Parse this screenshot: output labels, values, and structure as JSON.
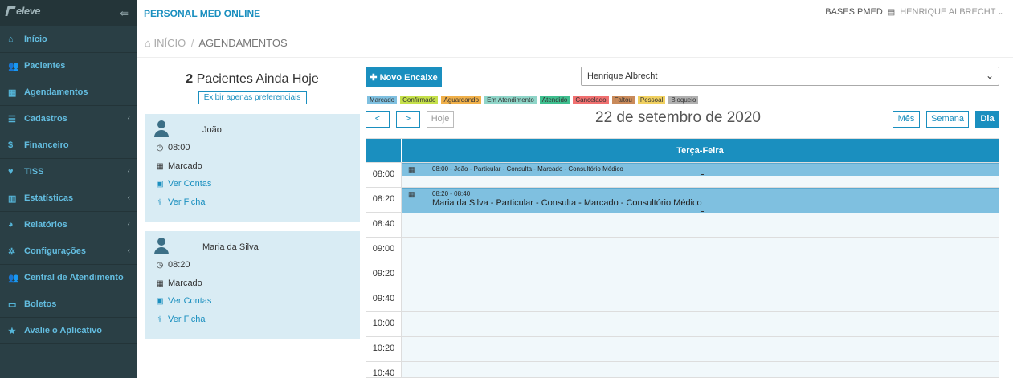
{
  "sidebar": {
    "logo": "eleve",
    "items": [
      {
        "icon": "home-icon",
        "glyph": "⌂",
        "label": "Início",
        "arrow": false
      },
      {
        "icon": "users-icon",
        "glyph": "👥",
        "label": "Pacientes",
        "arrow": false
      },
      {
        "icon": "calendar-icon",
        "glyph": "▦",
        "label": "Agendamentos",
        "arrow": false
      },
      {
        "icon": "list-icon",
        "glyph": "☰",
        "label": "Cadastros",
        "arrow": true
      },
      {
        "icon": "dollar-icon",
        "glyph": "$",
        "label": "Financeiro",
        "arrow": false
      },
      {
        "icon": "heartbeat-icon",
        "glyph": "♥",
        "label": "TISS",
        "arrow": true
      },
      {
        "icon": "bar-chart-icon",
        "glyph": "▥",
        "label": "Estatísticas",
        "arrow": true
      },
      {
        "icon": "pie-chart-icon",
        "glyph": "◕",
        "label": "Relatórios",
        "arrow": true
      },
      {
        "icon": "gear-icon",
        "glyph": "✲",
        "label": "Configurações",
        "arrow": true
      },
      {
        "icon": "group-icon",
        "glyph": "👥",
        "label": "Central de Atendimento",
        "arrow": false
      },
      {
        "icon": "money-icon",
        "glyph": "▭",
        "label": "Boletos",
        "arrow": false
      },
      {
        "icon": "star-icon",
        "glyph": "★",
        "label": "Avalie o Aplicativo",
        "arrow": false
      }
    ]
  },
  "topbar": {
    "brand": "PERSONAL MED ONLINE",
    "base": "BASES PMED",
    "user": "HENRIQUE ALBRECHT"
  },
  "breadcrumb": {
    "home": "INÍCIO",
    "current": "AGENDAMENTOS"
  },
  "left": {
    "count": "2",
    "count_label": "Pacientes Ainda Hoje",
    "pref_button": "Exibir apenas preferenciais",
    "patients": [
      {
        "name": "João",
        "time": "08:00",
        "status": "Marcado",
        "accounts": "Ver Contas",
        "chart": "Ver Ficha"
      },
      {
        "name": "Maria da Silva",
        "time": "08:20",
        "status": "Marcado",
        "accounts": "Ver Contas",
        "chart": "Ver Ficha"
      }
    ]
  },
  "calendar": {
    "new_button": "Novo Encaixe",
    "professional": "Henrique Albrecht",
    "legend": [
      {
        "label": "Marcado",
        "color": "#7fc0e0"
      },
      {
        "label": "Confirmado",
        "color": "#c5e04a"
      },
      {
        "label": "Aguardando",
        "color": "#f0b04a"
      },
      {
        "label": "Em Atendimento",
        "color": "#8fd5c8"
      },
      {
        "label": "Atendido",
        "color": "#3fbf8f"
      },
      {
        "label": "Cancelado",
        "color": "#f07070"
      },
      {
        "label": "Faltou",
        "color": "#c98a5a"
      },
      {
        "label": "Pessoal",
        "color": "#f0d060"
      },
      {
        "label": "Bloqueio",
        "color": "#b0b0b0"
      }
    ],
    "prev": "<",
    "next": ">",
    "today": "Hoje",
    "date": "22 de setembro de 2020",
    "views": {
      "month": "Mês",
      "week": "Semana",
      "day": "Dia"
    },
    "day_header": "Terça-Feira",
    "slots": [
      "08:00",
      "08:20",
      "08:40",
      "09:00",
      "09:20",
      "09:40",
      "10:00",
      "10:20",
      "10:40"
    ],
    "events": [
      {
        "small": "08:00 - João - Particular - Consulta - Marcado - Consultório Médico",
        "big": ""
      },
      {
        "small": "08:20 - 08:40",
        "big": "Maria da Silva - Particular - Consulta - Marcado - Consultório Médico"
      }
    ]
  }
}
